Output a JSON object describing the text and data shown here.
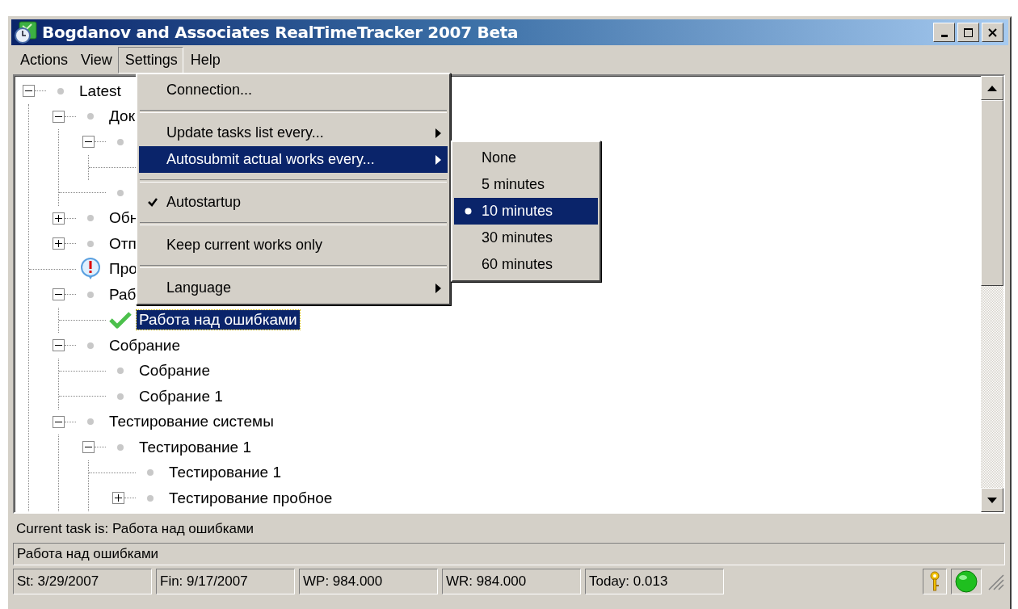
{
  "window": {
    "title": "Bogdanov and Associates RealTimeTracker 2007 Beta"
  },
  "menu_bar": [
    {
      "label": "Actions",
      "selected": false
    },
    {
      "label": "View",
      "selected": false
    },
    {
      "label": "Settings",
      "selected": true
    },
    {
      "label": "Help",
      "selected": false
    }
  ],
  "tree": {
    "nodes": [
      {
        "label": "Latest",
        "kind": "dot",
        "expanded": true,
        "selected": false,
        "children": [
          {
            "label": "Док",
            "kind": "dot",
            "expanded": true,
            "selected": false,
            "children": [
              {
                "kind": "dot",
                "expanded": true,
                "children": [
                  {
                    "kind": "line"
                  }
                ]
              },
              {
                "kind": "dot"
              }
            ]
          },
          {
            "label": "Обн",
            "kind": "dot",
            "expanded": false,
            "selected": false
          },
          {
            "label": "Отп",
            "kind": "dot",
            "expanded": false,
            "selected": false
          },
          {
            "label": "Про",
            "kind": "alert",
            "selected": false
          },
          {
            "label": "Раб",
            "kind": "dot",
            "expanded": true,
            "selected": false,
            "children": [
              {
                "label": "Работа над ошибками",
                "kind": "check",
                "selected": true
              }
            ]
          },
          {
            "label": "Собрание",
            "kind": "dot",
            "expanded": true,
            "selected": false,
            "children": [
              {
                "label": "Собрание",
                "kind": "dot",
                "selected": false
              },
              {
                "label": "Собрание 1",
                "kind": "dot",
                "selected": false
              }
            ]
          },
          {
            "label": "Тестирование системы",
            "kind": "dot",
            "expanded": true,
            "selected": false,
            "children": [
              {
                "label": "Тестирование 1",
                "kind": "dot",
                "expanded": true,
                "selected": false,
                "children": [
                  {
                    "label": "Тестирование 1",
                    "kind": "dot",
                    "selected": false
                  },
                  {
                    "label": "Тестирование пробное",
                    "kind": "dot",
                    "expanded": false,
                    "selected": false
                  }
                ]
              }
            ]
          }
        ]
      }
    ]
  },
  "settings_menu": [
    {
      "kind": "item",
      "label": "Connection...",
      "checked": false,
      "submenu": false,
      "selected": false
    },
    {
      "kind": "separator"
    },
    {
      "kind": "item",
      "label": "Update tasks list every...",
      "checked": false,
      "submenu": true,
      "selected": false
    },
    {
      "kind": "item",
      "label": "Autosubmit actual works every...",
      "checked": false,
      "submenu": true,
      "selected": true
    },
    {
      "kind": "separator"
    },
    {
      "kind": "item",
      "label": "Autostartup",
      "checked": true,
      "submenu": false,
      "selected": false
    },
    {
      "kind": "separator"
    },
    {
      "kind": "item",
      "label": "Keep current works only",
      "checked": false,
      "submenu": false,
      "selected": false
    },
    {
      "kind": "separator"
    },
    {
      "kind": "item",
      "label": "Language",
      "checked": false,
      "submenu": true,
      "selected": false
    }
  ],
  "autosubmit_submenu": [
    {
      "label": "None",
      "checked": false,
      "selected": false
    },
    {
      "label": "5 minutes",
      "checked": false,
      "selected": false
    },
    {
      "label": "10 minutes",
      "checked": true,
      "selected": true
    },
    {
      "label": "30 minutes",
      "checked": false,
      "selected": false
    },
    {
      "label": "60 minutes",
      "checked": false,
      "selected": false
    }
  ],
  "current_task": "Current task is: Работа над ошибками",
  "task_field": "Работа над ошибками",
  "status_bar": [
    "St: 3/29/2007",
    "Fin: 9/17/2007",
    "WP: 984.000",
    "WR: 984.000",
    "Today: 0.013"
  ]
}
